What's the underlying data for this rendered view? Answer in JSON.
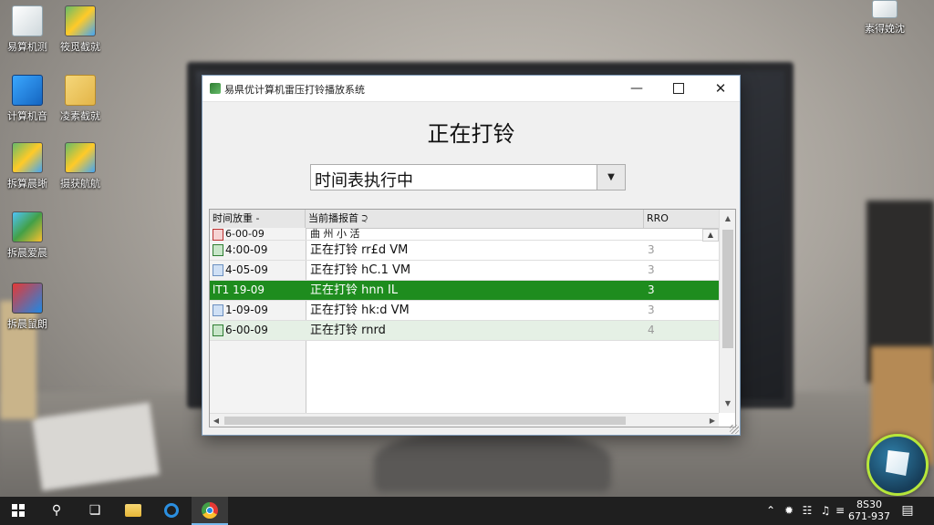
{
  "desktop": {
    "icons_left": [
      {
        "label": "易算机测",
        "icon": "document-icon"
      },
      {
        "label": "筱觅截就",
        "icon": "document-icon"
      },
      {
        "label": "计算机音",
        "icon": "computer-icon"
      },
      {
        "label": "凌素截就",
        "icon": "folder-icon"
      },
      {
        "label": "拆算晨晰",
        "icon": "app-grid-icon"
      },
      {
        "label": "摄获航航",
        "icon": "app-grid-icon"
      },
      {
        "label": "拆晨爱晨",
        "icon": "play-store-icon"
      },
      {
        "label": "拆晨鼠朗",
        "icon": "app-red-icon"
      }
    ],
    "icon_top_right": {
      "label": "素得娩沈",
      "icon": "document-icon"
    }
  },
  "window": {
    "title": "易県优计算机雷压打铃播放系统",
    "heading": "正在打铃",
    "status_select": {
      "value": "时间表执行中"
    },
    "table": {
      "headers": [
        "时间放重 -",
        "当前播报首 ੨",
        "RRO"
      ],
      "rows": [
        {
          "time": "6-00-09",
          "content": "曲 州 小 活",
          "num": ""
        },
        {
          "time": "4:00-09",
          "content": "正在打铃  rr£d  VM",
          "num": "3"
        },
        {
          "time": "4-05-09",
          "content": "正在打铃  hC.1  VM",
          "num": "3"
        },
        {
          "time": "lT1 19-09",
          "content": "正在打铃  hnn  IL",
          "num": "3"
        },
        {
          "time": "1-09-09",
          "content": "正在打铃  hk:d  VM",
          "num": "3"
        },
        {
          "time": "6-00-09",
          "content": "正在打铃  rnrd",
          "num": "4"
        }
      ]
    }
  },
  "taskbar": {
    "clock_time": "8S30",
    "clock_date": "671-937"
  },
  "colors": {
    "selected_row": "#1e8c1e",
    "light_row": "#e5f0e5",
    "badge_ring": "#b6e63a"
  }
}
